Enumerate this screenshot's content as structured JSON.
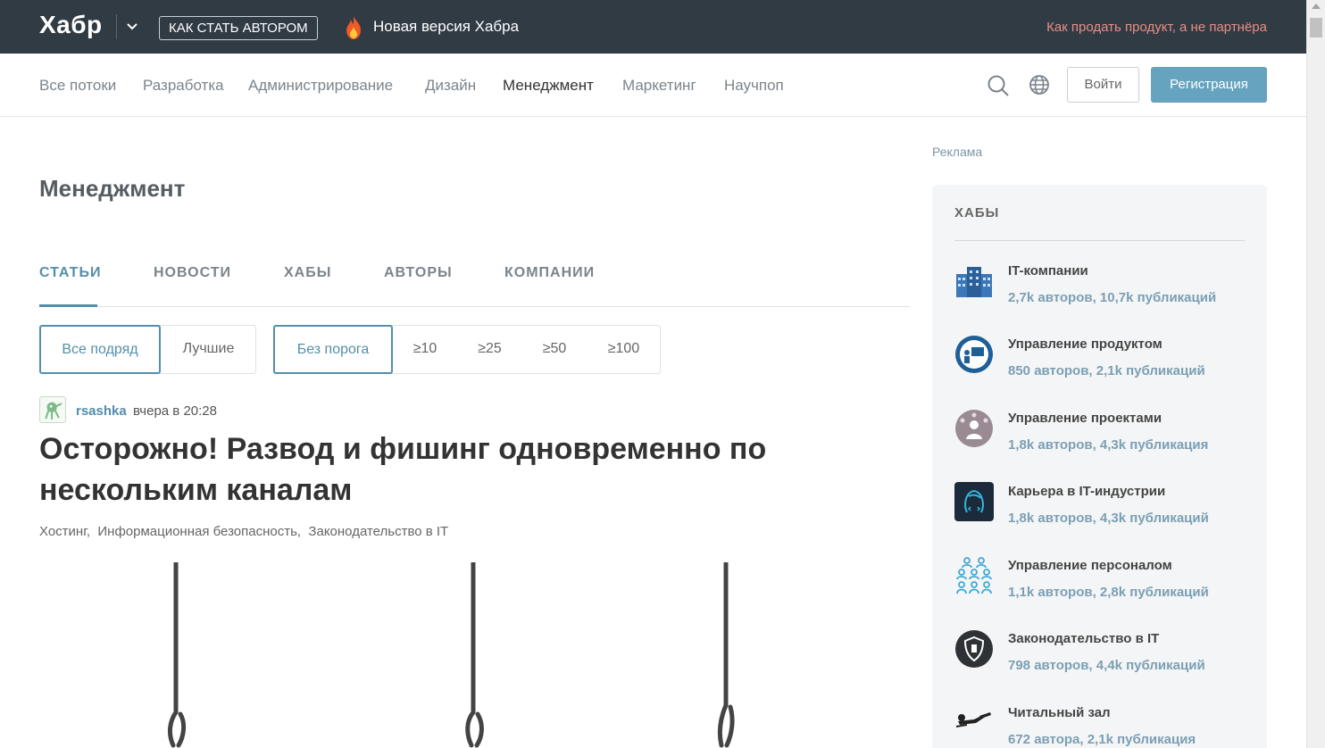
{
  "topbar": {
    "logo": "Хабр",
    "author_button": "КАК СТАТЬ АВТОРОМ",
    "new_version": "Новая версия Хабра",
    "promo": "Как продать продукт, а не партнёра"
  },
  "nav": {
    "items": [
      "Все потоки",
      "Разработка",
      "Администрирование",
      "Дизайн",
      "Менеджмент",
      "Маркетинг",
      "Научпоп"
    ],
    "active": "Менеджмент",
    "login": "Войти",
    "register": "Регистрация"
  },
  "page": {
    "title": "Менеджмент",
    "tabs": [
      "СТАТЬИ",
      "НОВОСТИ",
      "ХАБЫ",
      "АВТОРЫ",
      "КОМПАНИИ"
    ],
    "active_tab": "СТАТЬИ",
    "sort_filters": [
      "Все подряд",
      "Лучшие"
    ],
    "sort_active": "Все подряд",
    "threshold_filters": [
      "Без порога",
      "≥10",
      "≥25",
      "≥50",
      "≥100"
    ],
    "threshold_active": "Без порога"
  },
  "post": {
    "author": "rsashka",
    "time": "вчера в 20:28",
    "title": "Осторожно! Развод и фишинг одновременно по нескольким каналам",
    "hubs": [
      "Хостинг,",
      "Информационная безопасность,",
      "Законодательство в IT"
    ]
  },
  "sidebar": {
    "ad_label": "Реклама",
    "hubs_title": "ХАБЫ",
    "hubs": [
      {
        "name": "IT-компании",
        "stats": "2,7k авторов, 10,7k публикаций",
        "icon": "office-building-icon"
      },
      {
        "name": "Управление продуктом",
        "stats": "850 авторов, 2,1k публикаций",
        "icon": "product-presentation-icon"
      },
      {
        "name": "Управление проектами",
        "stats": "1,8k авторов, 4,3k публикация",
        "icon": "project-manager-icon"
      },
      {
        "name": "Карьера в IT-индустрии",
        "stats": "1,8k авторов, 4,3k публикаций",
        "icon": "developer-head-icon"
      },
      {
        "name": "Управление персоналом",
        "stats": "1,1k авторов, 2,8k публикаций",
        "icon": "people-group-icon"
      },
      {
        "name": "Законодательство в IT",
        "stats": "798 авторов, 4,4k публикаций",
        "icon": "shield-law-icon"
      },
      {
        "name": "Читальный зал",
        "stats": "672 автора, 2,1k публикация",
        "icon": "reading-person-icon"
      }
    ]
  },
  "colors": {
    "topbar_bg": "#303b44",
    "accent": "#548eaa",
    "register_bg": "#65a3be",
    "promo": "#e88e84"
  }
}
